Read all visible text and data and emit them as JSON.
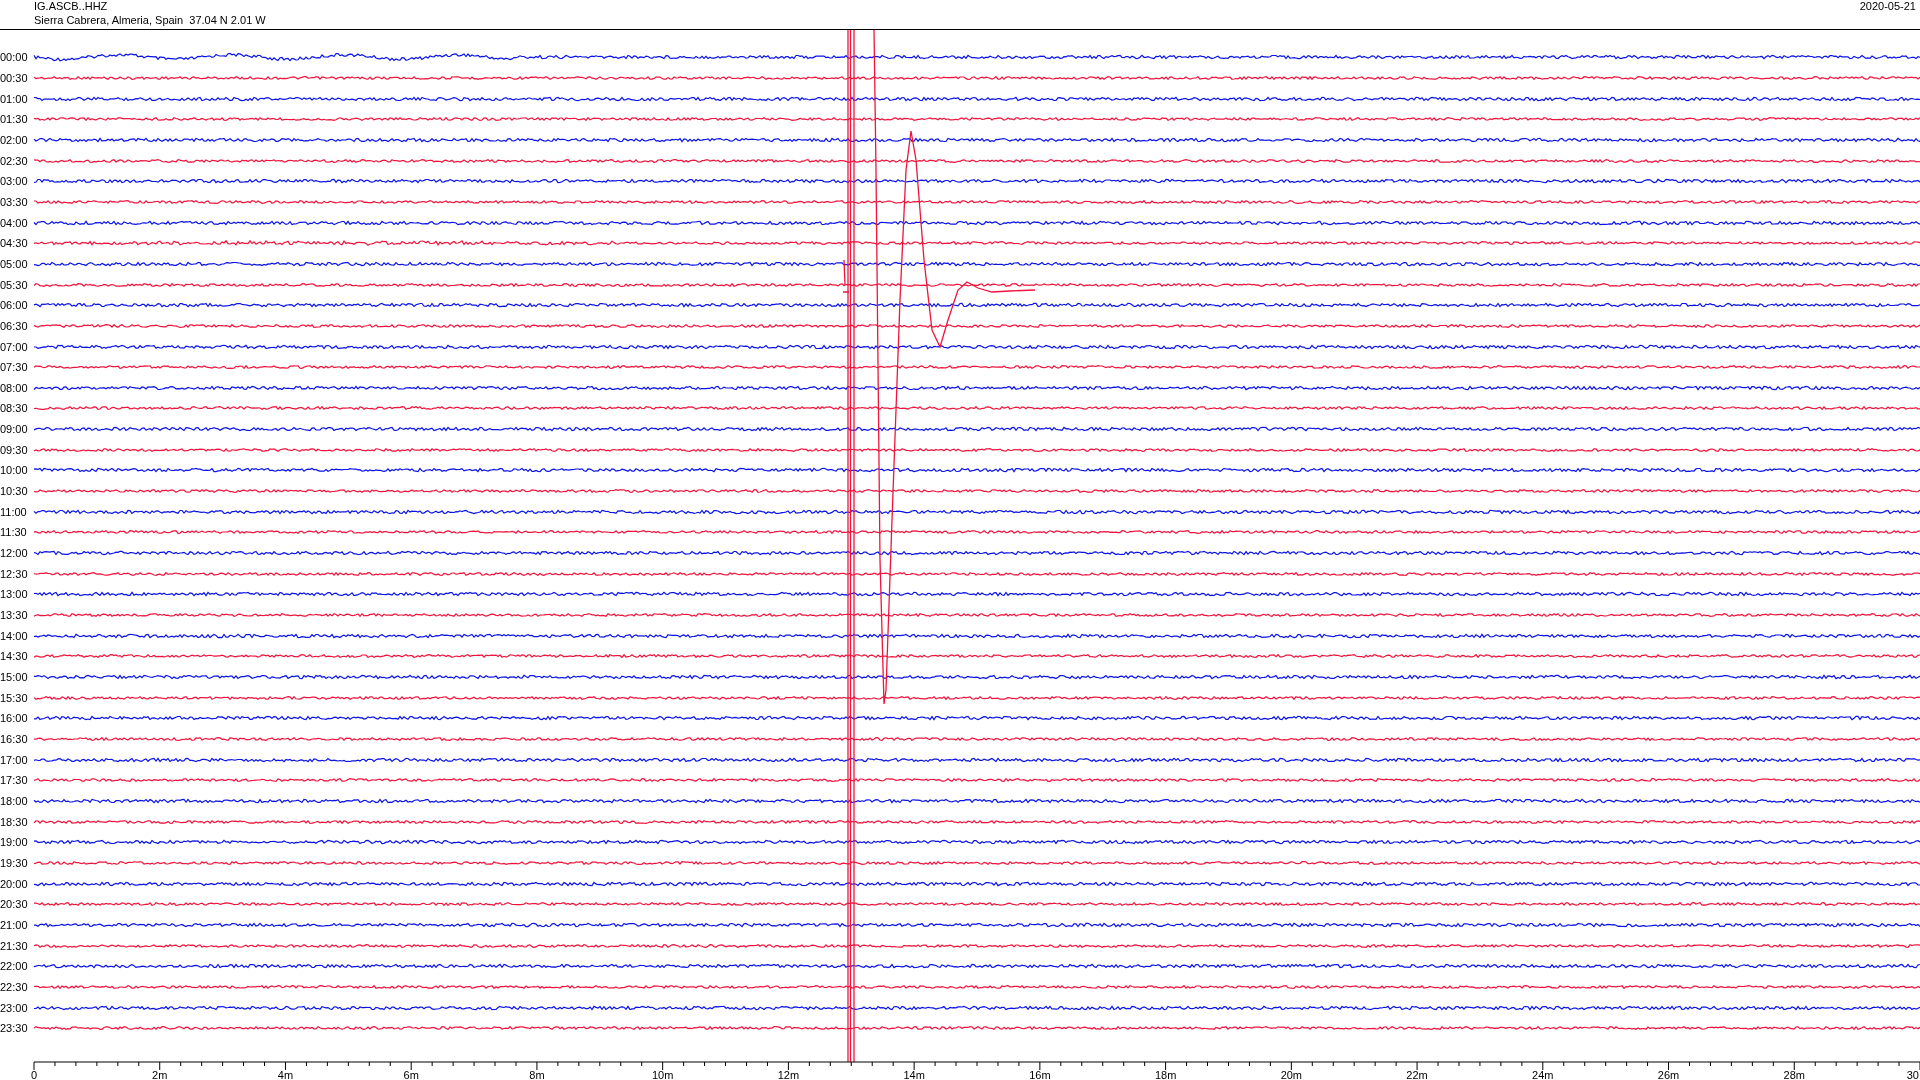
{
  "header": {
    "station": "IG.ASCB..HHZ",
    "location": "Sierra Cabrera, Almeria, Spain  37.04 N 2.01 W",
    "date": "2020-05-21"
  },
  "traces": [
    {
      "label": "00:00",
      "color": "#0a14e6"
    },
    {
      "label": "00:30",
      "color": "#f0143c"
    },
    {
      "label": "01:00",
      "color": "#0a14e6"
    },
    {
      "label": "01:30",
      "color": "#f0143c"
    },
    {
      "label": "02:00",
      "color": "#0a14e6"
    },
    {
      "label": "02:30",
      "color": "#f0143c"
    },
    {
      "label": "03:00",
      "color": "#0a14e6"
    },
    {
      "label": "03:30",
      "color": "#f0143c"
    },
    {
      "label": "04:00",
      "color": "#0a14e6"
    },
    {
      "label": "04:30",
      "color": "#f0143c"
    },
    {
      "label": "05:00",
      "color": "#0a14e6"
    },
    {
      "label": "05:30",
      "color": "#f0143c"
    },
    {
      "label": "06:00",
      "color": "#0a14e6"
    },
    {
      "label": "06:30",
      "color": "#f0143c"
    },
    {
      "label": "07:00",
      "color": "#0a14e6"
    },
    {
      "label": "07:30",
      "color": "#f0143c"
    },
    {
      "label": "08:00",
      "color": "#0a14e6"
    },
    {
      "label": "08:30",
      "color": "#f0143c"
    },
    {
      "label": "09:00",
      "color": "#0a14e6"
    },
    {
      "label": "09:30",
      "color": "#f0143c"
    },
    {
      "label": "10:00",
      "color": "#0a14e6"
    },
    {
      "label": "10:30",
      "color": "#f0143c"
    },
    {
      "label": "11:00",
      "color": "#0a14e6"
    },
    {
      "label": "11:30",
      "color": "#f0143c"
    },
    {
      "label": "12:00",
      "color": "#0a14e6"
    },
    {
      "label": "12:30",
      "color": "#f0143c"
    },
    {
      "label": "13:00",
      "color": "#0a14e6"
    },
    {
      "label": "13:30",
      "color": "#f0143c"
    },
    {
      "label": "14:00",
      "color": "#0a14e6"
    },
    {
      "label": "14:30",
      "color": "#f0143c"
    },
    {
      "label": "15:00",
      "color": "#0a14e6"
    },
    {
      "label": "15:30",
      "color": "#f0143c"
    },
    {
      "label": "16:00",
      "color": "#0a14e6"
    },
    {
      "label": "16:30",
      "color": "#f0143c"
    },
    {
      "label": "17:00",
      "color": "#0a14e6"
    },
    {
      "label": "17:30",
      "color": "#f0143c"
    },
    {
      "label": "18:00",
      "color": "#0a14e6"
    },
    {
      "label": "18:30",
      "color": "#f0143c"
    },
    {
      "label": "19:00",
      "color": "#0a14e6"
    },
    {
      "label": "19:30",
      "color": "#f0143c"
    },
    {
      "label": "20:00",
      "color": "#0a14e6"
    },
    {
      "label": "20:30",
      "color": "#f0143c"
    },
    {
      "label": "21:00",
      "color": "#0a14e6"
    },
    {
      "label": "21:30",
      "color": "#f0143c"
    },
    {
      "label": "22:00",
      "color": "#0a14e6"
    },
    {
      "label": "22:30",
      "color": "#f0143c"
    },
    {
      "label": "23:00",
      "color": "#0a14e6"
    },
    {
      "label": "23:30",
      "color": "#f0143c"
    }
  ],
  "x_axis": {
    "ticks": [
      "0",
      "2m",
      "4m",
      "6m",
      "8m",
      "10m",
      "12m",
      "14m",
      "16m",
      "18m",
      "20m",
      "22m",
      "24m",
      "26m",
      "28m",
      "30"
    ]
  }
}
